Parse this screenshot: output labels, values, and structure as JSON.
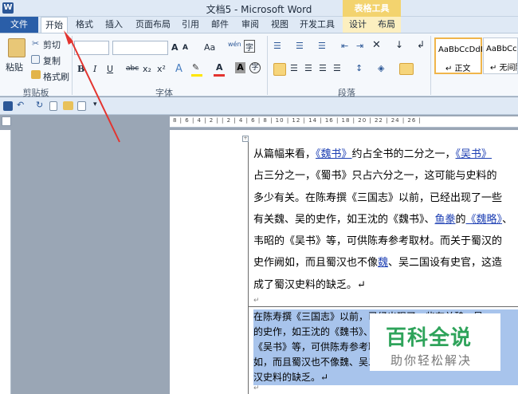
{
  "window": {
    "title": "文档5 - Microsoft Word",
    "app_icon": "W",
    "tools_banner": "表格工具"
  },
  "tabs": [
    "文件",
    "开始",
    "格式",
    "插入",
    "页面布局",
    "引用",
    "邮件",
    "审阅",
    "视图",
    "开发工具",
    "设计",
    "布局"
  ],
  "ribbon": {
    "clipboard": {
      "paste": "粘贴",
      "cut": "剪切",
      "copy": "复制",
      "format_painter": "格式刷",
      "group_label": "剪贴板"
    },
    "font": {
      "group_label": "字体",
      "grow": "A",
      "shrink": "A",
      "change_case": "Aa",
      "phonetic": "wén",
      "bold": "B",
      "italic": "I",
      "underline": "U",
      "strike": "abc",
      "sub": "x₂",
      "sup": "x²",
      "highlight": "A",
      "color": "A",
      "shade": "A",
      "enclose": "字"
    },
    "paragraph": {
      "group_label": "段落"
    },
    "styles": [
      {
        "preview": "AaBbCcDdI",
        "name": "↵ 正文"
      },
      {
        "preview": "AaBbCcDd",
        "name": "↵ 无间隔"
      }
    ]
  },
  "ruler_numbers": "8 | 6 | 4 | 2 |   | 2 | 4 | 6 | 8 | 10 | 12 | 14 | 16 | 18 | 20 | 22 | 24 | 26 |",
  "para1": [
    [
      {
        "t": "从篇幅来看，"
      },
      {
        "t": "《魏书》",
        "l": 1
      },
      {
        "t": "约占全书的二分之一，"
      },
      {
        "t": "《吴书》",
        "l": 1
      }
    ],
    [
      {
        "t": "占三分之一，《蜀书》只占六分之一，这可能与史料的"
      }
    ],
    [
      {
        "t": "多少有关。在陈寿撰《三国志》以前，已经出现了一些"
      }
    ],
    [
      {
        "t": "有关魏、吴的史作，如王沈的《魏书》、"
      },
      {
        "t": "鱼豢",
        "l": 1
      },
      {
        "t": "的"
      },
      {
        "t": "《魏略》",
        "l": 1
      },
      {
        "t": "、"
      }
    ],
    [
      {
        "t": "韦昭的《吴书》等，可供陈寿参考取材。而关于蜀汉的"
      }
    ],
    [
      {
        "t": "史作阙如，而且蜀汉也不像"
      },
      {
        "t": "魏",
        "l": 1
      },
      {
        "t": "、吴二国设有史官，这造"
      }
    ],
    [
      {
        "t": "成了蜀汉史料的缺乏。↵"
      }
    ]
  ],
  "para2": [
    "在陈寿撰《三国志》以前，已经出现了一些有关魏、吴",
    "的史作，如王沈的《魏书》、鱼豢的《魏略》、韦昭的",
    "《吴书》等，可供陈寿参考取材。而关于蜀汉的史作阙",
    "如，而且蜀汉也不像魏、吴二国设有史官，这造成了蜀",
    "汉史料的缺乏。↵"
  ],
  "end_marks": [
    "↵",
    "↵"
  ],
  "watermark": {
    "title": "百科全说",
    "subtitle": "助你轻松解决"
  },
  "annotation_color": "#e3342f"
}
